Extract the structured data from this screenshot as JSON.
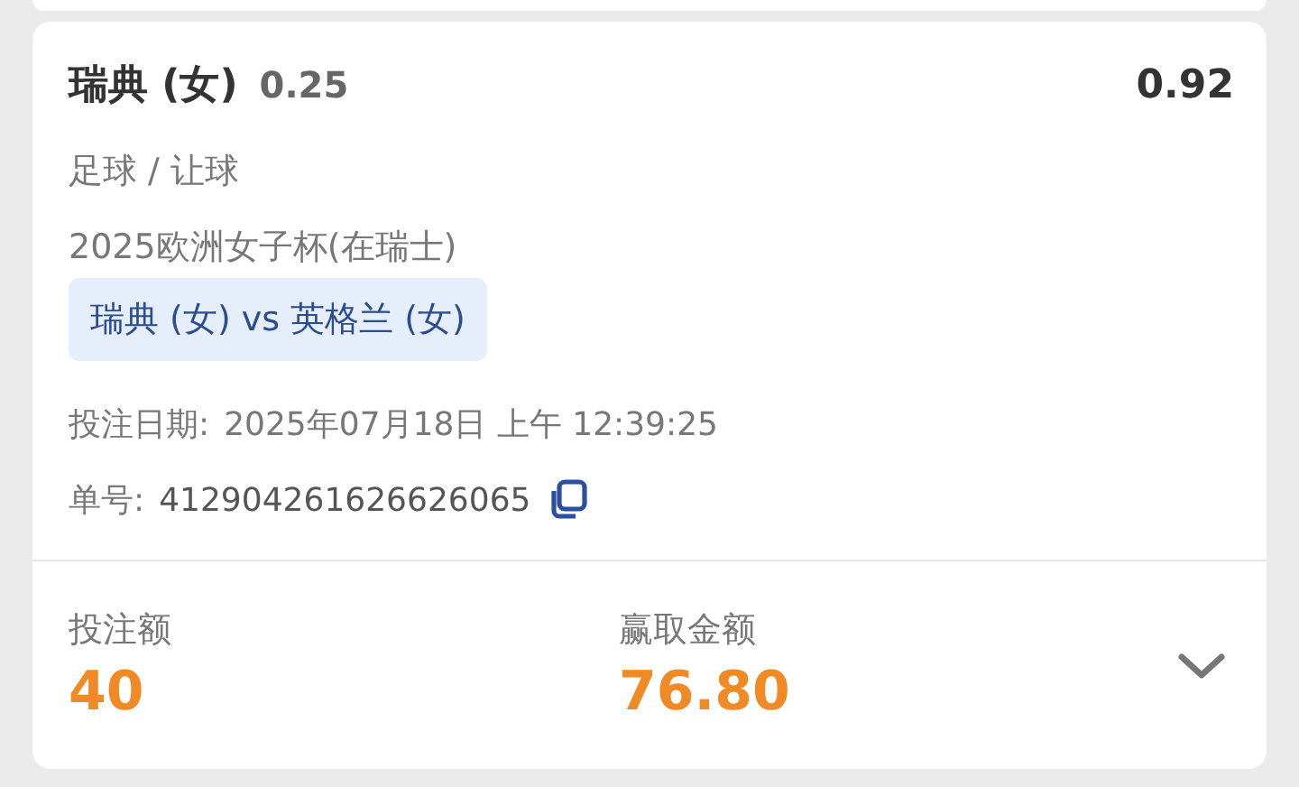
{
  "bet": {
    "selection": "瑞典 (女)",
    "handicap": "0.25",
    "odds": "0.92",
    "sport": "足球 / 让球",
    "league": "2025欧洲女子杯(在瑞士)",
    "match": "瑞典 (女) vs 英格兰 (女)",
    "date_label": "投注日期:",
    "date": "2025年07月18日 上午 12:39:25",
    "id_label": "单号:",
    "id": "412904261626626065"
  },
  "summary": {
    "stake_label": "投注额",
    "stake": "40",
    "win_label": "赢取金额",
    "win": "76.80",
    "expanded": false
  }
}
